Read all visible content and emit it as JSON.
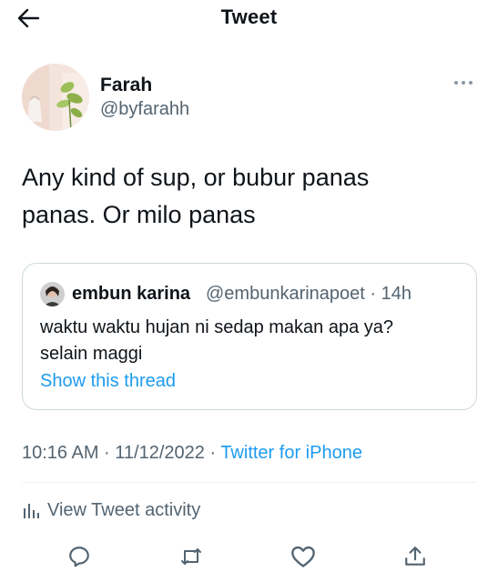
{
  "header": {
    "title": "Tweet"
  },
  "author": {
    "name": "Farah",
    "handle": "@byfarahh"
  },
  "tweet": {
    "line1": "Any kind of sup, or bubur panas",
    "line2": "panas. Or milo panas"
  },
  "quote": {
    "name": "embun karina",
    "meta": "@embunkarinapoet · 14h",
    "line1": "waktu waktu hujan ni sedap makan apa ya?",
    "line2": "selain maggi",
    "show_thread": "Show this thread"
  },
  "meta": {
    "timestamp": "10:16 AM · 11/12/2022 · ",
    "source": "Twitter for iPhone"
  },
  "activity": {
    "label": "View Tweet activity"
  },
  "colors": {
    "accent": "#1d9bf0",
    "secondary_text": "#536471",
    "border": "#cfd9de"
  },
  "icons": [
    "back-arrow-icon",
    "more-icon",
    "bar-chart-icon",
    "reply-icon",
    "retweet-icon",
    "like-icon",
    "share-icon"
  ]
}
